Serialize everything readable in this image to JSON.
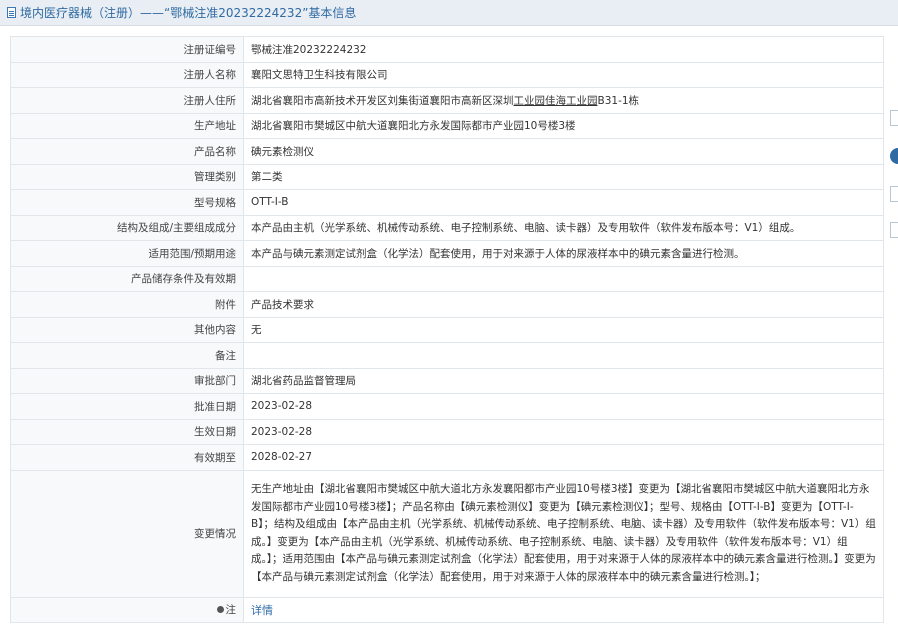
{
  "header": {
    "title": "境内医疗器械（注册）——“鄂械注准20232224232”基本信息"
  },
  "rows": [
    {
      "label": "注册证编号",
      "value": "鄂械注准20232224232"
    },
    {
      "label": "注册人名称",
      "value": "襄阳文思特卫生科技有限公司"
    },
    {
      "label": "注册人住所",
      "value_a": "湖北省襄阳市高新技术开发区刘集街道襄阳市高新区深圳",
      "value_u": "工业园佳海工业园",
      "value_b": "B31-1栋"
    },
    {
      "label": "生产地址",
      "value": "湖北省襄阳市樊城区中航大道襄阳北方永发国际都市产业园10号楼3楼"
    },
    {
      "label": "产品名称",
      "value": "碘元素检测仪"
    },
    {
      "label": "管理类别",
      "value": "第二类"
    },
    {
      "label": "型号规格",
      "value": "OTT-I-B"
    },
    {
      "label": "结构及组成/主要组成成分",
      "value": "本产品由主机（光学系统、机械传动系统、电子控制系统、电脑、读卡器）及专用软件（软件发布版本号：V1）组成。"
    },
    {
      "label": "适用范围/预期用途",
      "value": "本产品与碘元素测定试剂盒（化学法）配套使用，用于对来源于人体的尿液样本中的碘元素含量进行检测。"
    },
    {
      "label": "产品储存条件及有效期",
      "value": ""
    },
    {
      "label": "附件",
      "value": "产品技术要求"
    },
    {
      "label": "其他内容",
      "value": "无"
    },
    {
      "label": "备注",
      "value": ""
    },
    {
      "label": "审批部门",
      "value": "湖北省药品监督管理局"
    },
    {
      "label": "批准日期",
      "value": "2023-02-28"
    },
    {
      "label": "生效日期",
      "value": "2023-02-28"
    },
    {
      "label": "有效期至",
      "value": "2028-02-27"
    },
    {
      "label": "变更情况",
      "value": "无生产地址由【湖北省襄阳市樊城区中航大道北方永发襄阳都市产业园10号楼3楼】变更为【湖北省襄阳市樊城区中航大道襄阳北方永发国际都市产业园10号楼3楼】；产品名称由【碘元素检测仪】变更为【碘元素检测仪】；型号、规格由【OTT-I-B】变更为【OTT-I-B】；结构及组成由【本产品由主机（光学系统、机械传动系统、电子控制系统、电脑、读卡器）及专用软件（软件发布版本号：V1）组成。】变更为【本产品由主机（光学系统、机械传动系统、电子控制系统、电脑、读卡器）及专用软件（软件发布版本号：V1）组成。】；适用范围由【本产品与碘元素测定试剂盒（化学法）配套使用，用于对来源于人体的尿液样本中的碘元素含量进行检测。】变更为【本产品与碘元素测定试剂盒（化学法）配套使用，用于对来源于人体的尿液样本中的碘元素含量进行检测。】；"
    },
    {
      "label": "注",
      "value": "详情"
    }
  ]
}
